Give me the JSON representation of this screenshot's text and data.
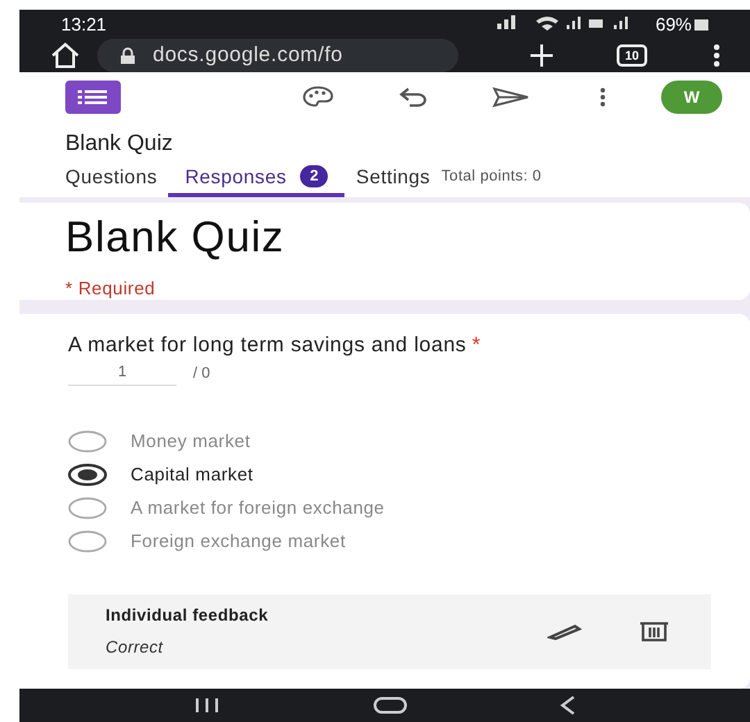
{
  "status_bar": {
    "time": "13:21",
    "battery": "69%"
  },
  "browser": {
    "url": "docs.google.com/fo",
    "tab_count": "10"
  },
  "app_bar": {
    "avatar": "W"
  },
  "form_title": "Blank Quiz",
  "tabs": [
    {
      "label": "Questions",
      "selected": false
    },
    {
      "label": "Responses",
      "selected": true,
      "badge": "2"
    },
    {
      "label": "Settings",
      "selected": false
    }
  ],
  "total_points": "Total points: 0",
  "header_card": {
    "title": "Blank Quiz",
    "required_note": "* Required"
  },
  "question": {
    "text": "A market for long term savings and loans",
    "required_mark": "*",
    "score": "1",
    "max_score": "/ 0",
    "options": [
      {
        "label": "Money market",
        "selected": false
      },
      {
        "label": "Capital market",
        "selected": true
      },
      {
        "label": "A market for foreign exchange",
        "selected": false
      },
      {
        "label": "Foreign exchange market",
        "selected": false
      }
    ],
    "feedback": {
      "title": "Individual feedback",
      "text": "Correct"
    }
  }
}
